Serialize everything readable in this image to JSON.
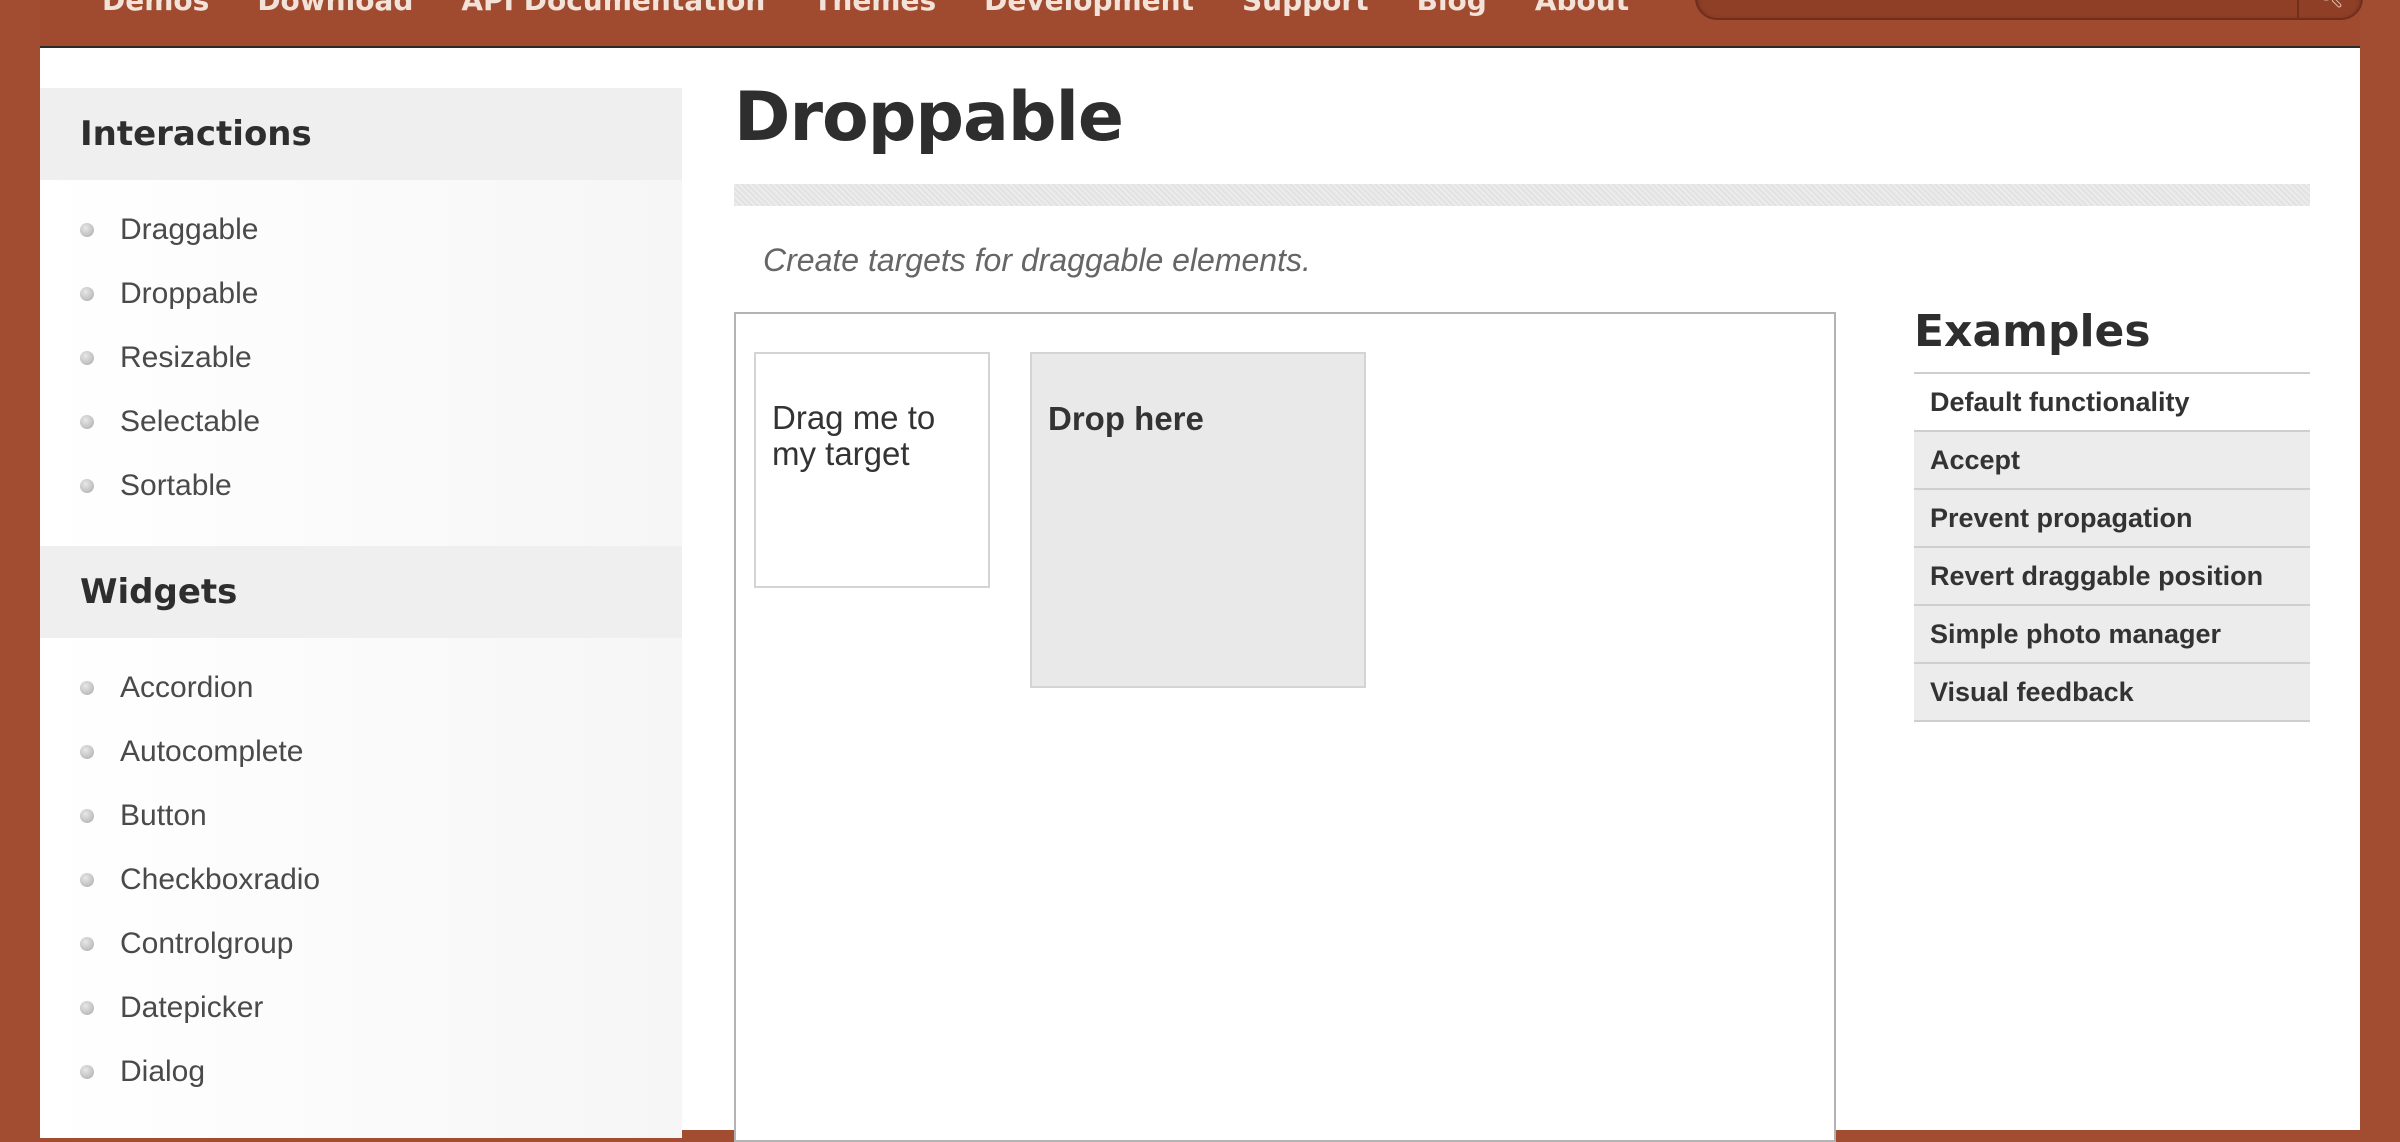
{
  "nav": {
    "items": [
      "Demos",
      "Download",
      "API Documentation",
      "Themes",
      "Development",
      "Support",
      "Blog",
      "About"
    ],
    "search_icon": "search-icon"
  },
  "sidebar": {
    "sections": [
      {
        "heading": "Interactions",
        "items": [
          "Draggable",
          "Droppable",
          "Resizable",
          "Selectable",
          "Sortable"
        ]
      },
      {
        "heading": "Widgets",
        "items": [
          "Accordion",
          "Autocomplete",
          "Button",
          "Checkboxradio",
          "Controlgroup",
          "Datepicker",
          "Dialog"
        ]
      }
    ]
  },
  "page": {
    "title": "Droppable",
    "subtitle": "Create targets for draggable elements."
  },
  "demo": {
    "draggable_label": "Drag me to my target",
    "droppable_label": "Drop here"
  },
  "examples": {
    "heading": "Examples",
    "items": [
      "Default functionality",
      "Accept",
      "Prevent propagation",
      "Revert draggable position",
      "Simple photo manager",
      "Visual feedback"
    ]
  },
  "colors": {
    "brand_background": "#a24d31",
    "panel_background": "#ffffff",
    "droppable_fill": "#e9e9e9"
  }
}
